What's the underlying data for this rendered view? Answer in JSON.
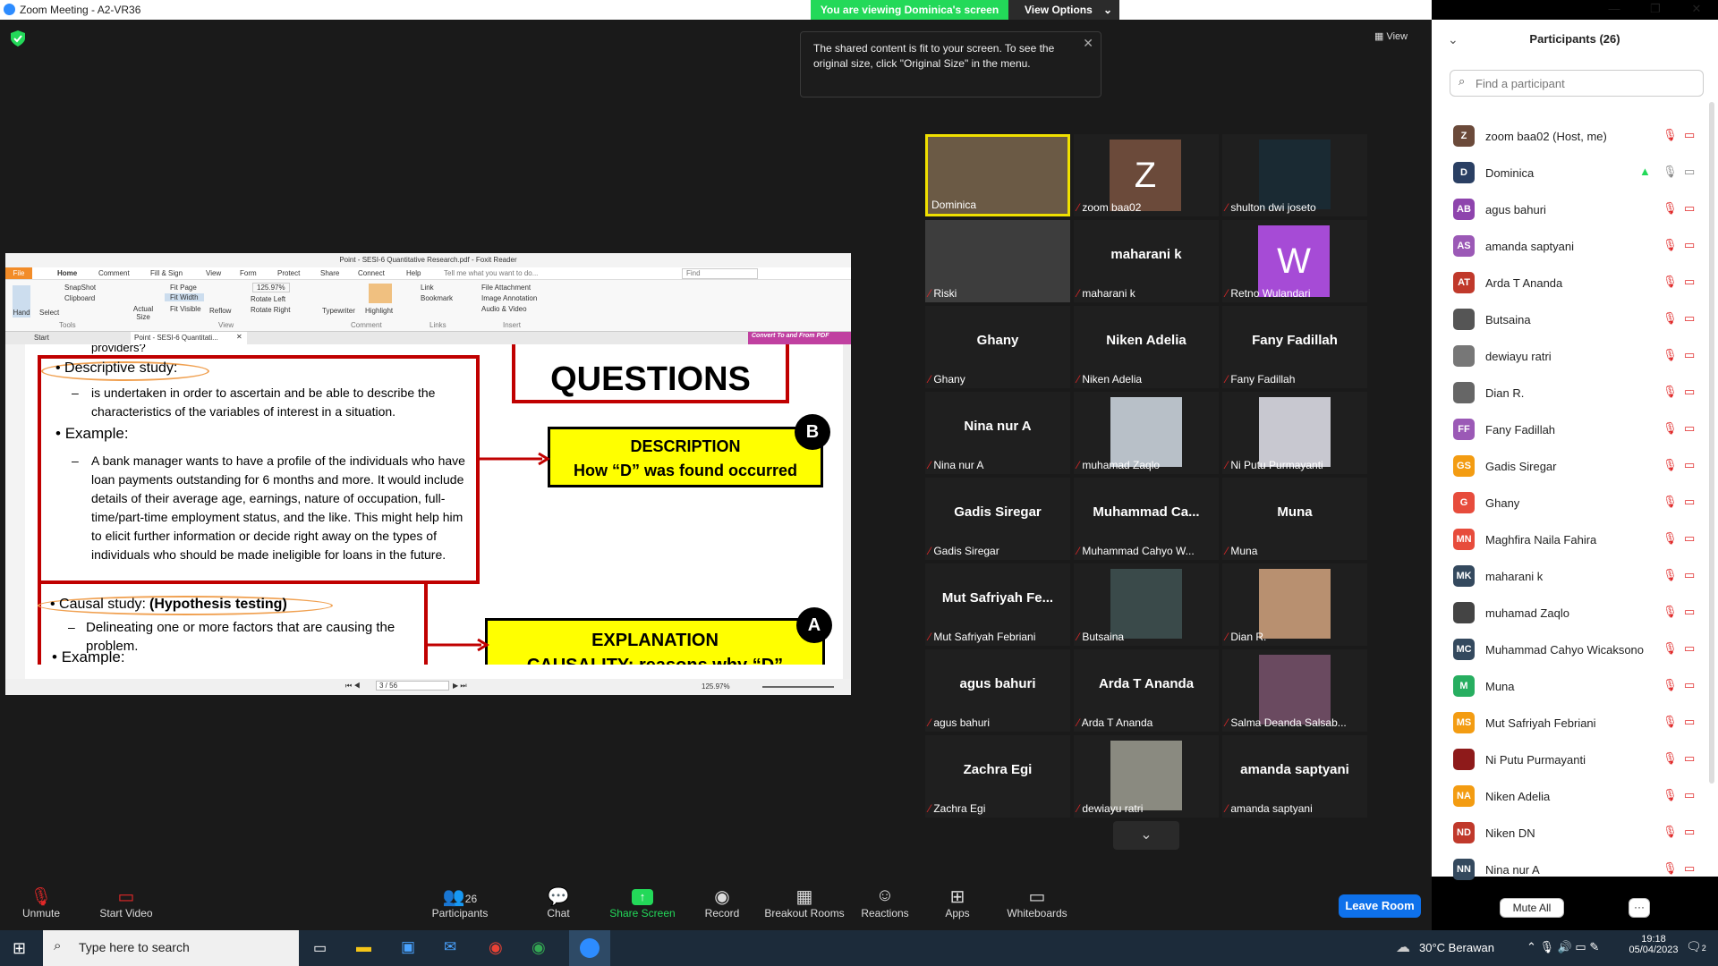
{
  "window": {
    "title": "Zoom Meeting - A2-VR36",
    "viewing_banner": "You are viewing Dominica's screen",
    "view_options": "View Options",
    "view_label": "View"
  },
  "tooltip": {
    "text": "The shared content is fit to your screen. To see the original size, click \"Original Size\" in the menu."
  },
  "doc": {
    "title": "Point - SESI-6 Quantitative Research.pdf - Foxit Reader",
    "menu": [
      "File",
      "Home",
      "Comment",
      "Fill & Sign",
      "View",
      "Form",
      "Protect",
      "Share",
      "Connect",
      "Help"
    ],
    "tell_me": "Tell me what you want to do...",
    "find": "Find",
    "ribbon": {
      "hand": "Hand",
      "select": "Select",
      "snapshot": "SnapShot",
      "clipboard": "Clipboard",
      "actual_size": "Actual Size",
      "fit_page": "Fit Page",
      "fit_width": "Fit Width",
      "fit_visible": "Fit Visible",
      "reflow": "Reflow",
      "zoom": "125.97%",
      "rotate_left": "Rotate Left",
      "rotate_right": "Rotate Right",
      "typewriter": "Typewriter",
      "highlight": "Highlight",
      "link": "Link",
      "bookmark": "Bookmark",
      "file_attachment": "File Attachment",
      "image_annotation": "Image Annotation",
      "audio_video": "Audio & Video",
      "grp_tools": "Tools",
      "grp_view": "View",
      "grp_comment": "Comment",
      "grp_links": "Links",
      "grp_insert": "Insert",
      "convert": "Convert To and From PDF"
    },
    "tabs": {
      "start": "Start",
      "doc": "Point - SESI-6 Quantitati..."
    },
    "page": {
      "top_cut": "providers?",
      "desc_heading": "Descriptive study:",
      "desc_text": "is undertaken in order to ascertain and be able to describe the characteristics of the variables of interest in a situation.",
      "example1": "Example:",
      "example1_text": "A bank manager wants to have a profile of the individuals who have loan payments outstanding for 6 months and more. It would include details of their average age, earnings, nature of occupation, full-time/part-time employment status, and the like. This might help him to elicit further information or decide right away on the types of individuals who should be made ineligible for loans in the future.",
      "causal_heading": "Causal study:",
      "causal_paren": "(Hypothesis testing)",
      "causal_text": "Delineating one or more factors that are causing the problem.",
      "example2": "Example:",
      "questions": "QUESTIONS",
      "desc_box_l1": "DESCRIPTION",
      "desc_box_l2": "How “D” was found occurred",
      "badge_b": "B",
      "expl_l1": "EXPLANATION",
      "expl_l2": "CAUSALITY: reasons why “D” occurred",
      "badge_a": "A"
    },
    "status": {
      "page": "3 / 56",
      "zoom": "125.97%"
    }
  },
  "tiles": [
    {
      "name": "Dominica",
      "big": "",
      "muted": false
    },
    {
      "name": "zoom baa02",
      "big": "Z",
      "muted": true
    },
    {
      "name": "shulton dwi joseto",
      "big": "",
      "muted": true
    },
    {
      "name": "Riski",
      "big": "",
      "muted": true
    },
    {
      "name": "maharani k",
      "big": "maharani k",
      "muted": true
    },
    {
      "name": "Retno Wulandari",
      "big": "W",
      "muted": true
    },
    {
      "name": "Ghany",
      "big": "Ghany",
      "muted": true
    },
    {
      "name": "Niken Adelia",
      "big": "Niken Adelia",
      "muted": true
    },
    {
      "name": "Fany Fadillah",
      "big": "Fany Fadillah",
      "muted": true
    },
    {
      "name": "Nina nur A",
      "big": "Nina nur A",
      "muted": true
    },
    {
      "name": "muhamad Zaqlo",
      "big": "",
      "muted": true
    },
    {
      "name": "Ni Putu Purmayanti",
      "big": "",
      "muted": true
    },
    {
      "name": "Gadis Siregar",
      "big": "Gadis Siregar",
      "muted": true
    },
    {
      "name": "Muhammad Cahyo W...",
      "big": "Muhammad  Ca...",
      "muted": true
    },
    {
      "name": "Muna",
      "big": "Muna",
      "muted": true
    },
    {
      "name": "Mut Safriyah Febriani",
      "big": "Mut  Safriyah  Fe...",
      "muted": true
    },
    {
      "name": "Butsaina",
      "big": "",
      "muted": true
    },
    {
      "name": "Dian R.",
      "big": "",
      "muted": true
    },
    {
      "name": "agus bahuri",
      "big": "agus bahuri",
      "muted": true
    },
    {
      "name": "Arda T Ananda",
      "big": "Arda T Ananda",
      "muted": true
    },
    {
      "name": "Salma Deanda Salsab...",
      "big": "",
      "muted": true
    },
    {
      "name": "Zachra Egi",
      "big": "Zachra Egi",
      "muted": true
    },
    {
      "name": "dewiayu ratri",
      "big": "",
      "muted": true
    },
    {
      "name": "amanda saptyani",
      "big": "amanda saptyani",
      "muted": true
    }
  ],
  "participants": {
    "header": "Participants (26)",
    "search_placeholder": "Find a participant",
    "mute_all": "Mute All",
    "list": [
      {
        "initials": "Z",
        "name": "zoom baa02 (Host, me)",
        "color": "#6b4a3a"
      },
      {
        "initials": "D",
        "name": "Dominica",
        "color": "#2a3f63"
      },
      {
        "initials": "AB",
        "name": "agus bahuri",
        "color": "#8e44ad"
      },
      {
        "initials": "AS",
        "name": "amanda saptyani",
        "color": "#9b59b6"
      },
      {
        "initials": "AT",
        "name": "Arda T Ananda",
        "color": "#c0392b"
      },
      {
        "initials": "",
        "name": "Butsaina",
        "color": "#555555"
      },
      {
        "initials": "",
        "name": "dewiayu ratri",
        "color": "#777777"
      },
      {
        "initials": "",
        "name": "Dian R.",
        "color": "#666666"
      },
      {
        "initials": "FF",
        "name": "Fany Fadillah",
        "color": "#9b59b6"
      },
      {
        "initials": "GS",
        "name": "Gadis Siregar",
        "color": "#f39c12"
      },
      {
        "initials": "G",
        "name": "Ghany",
        "color": "#e74c3c"
      },
      {
        "initials": "MN",
        "name": "Maghfira Naila Fahira",
        "color": "#e74c3c"
      },
      {
        "initials": "MK",
        "name": "maharani k",
        "color": "#34495e"
      },
      {
        "initials": "",
        "name": "muhamad Zaqlo",
        "color": "#444444"
      },
      {
        "initials": "MC",
        "name": "Muhammad Cahyo Wicaksono",
        "color": "#34495e"
      },
      {
        "initials": "M",
        "name": "Muna",
        "color": "#27ae60"
      },
      {
        "initials": "MS",
        "name": "Mut Safriyah Febriani",
        "color": "#f39c12"
      },
      {
        "initials": "",
        "name": "Ni Putu Purmayanti",
        "color": "#8e1a1a"
      },
      {
        "initials": "NA",
        "name": "Niken Adelia",
        "color": "#f39c12"
      },
      {
        "initials": "ND",
        "name": "Niken DN",
        "color": "#c0392b"
      },
      {
        "initials": "NN",
        "name": "Nina nur A",
        "color": "#34495e"
      }
    ]
  },
  "toolbar": {
    "unmute": "Unmute",
    "start_video": "Start Video",
    "participants": "Participants",
    "participants_count": "26",
    "chat": "Chat",
    "share_screen": "Share Screen",
    "record": "Record",
    "breakout": "Breakout Rooms",
    "reactions": "Reactions",
    "apps": "Apps",
    "whiteboards": "Whiteboards",
    "leave": "Leave Room"
  },
  "taskbar": {
    "search": "Type here to search",
    "weather": "30°C  Berawan",
    "time": "19:18",
    "date": "05/04/2023",
    "notif": "2"
  }
}
